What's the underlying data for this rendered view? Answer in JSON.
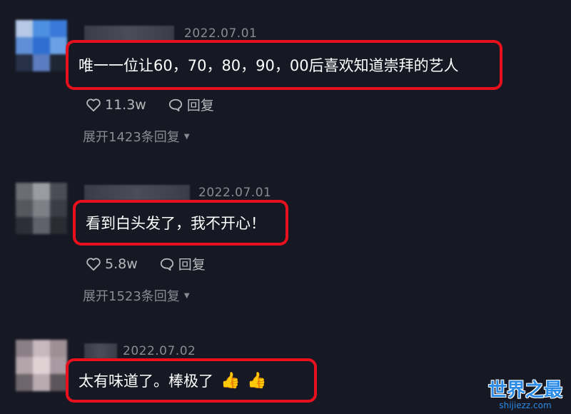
{
  "comments": [
    {
      "date": "2022.07.01",
      "text": "唯一一位让60，70，80，90，00后喜欢知道崇拜的艺人",
      "likes": "11.3w",
      "reply_label": "回复",
      "expand_label": "展开1423条回复",
      "emojis": []
    },
    {
      "date": "2022.07.01",
      "text": "看到白头发了，我不开心！",
      "likes": "5.8w",
      "reply_label": "回复",
      "expand_label": "展开1523条回复",
      "emojis": []
    },
    {
      "date": "2022.07.02",
      "text": "太有味道了。棒极了",
      "emojis": [
        "👍",
        "👍"
      ]
    }
  ],
  "icons": {
    "like": "heart-icon",
    "reply": "speech-bubble-icon",
    "expand": "caret-down-icon",
    "emoji": "thumbs-up-emoji"
  },
  "colors": {
    "background": "#161823",
    "highlight_border": "#e8101c",
    "meta_text": "#8a8b91",
    "watermark": "#2b8be6"
  },
  "watermark": {
    "title": "世界之最",
    "subtitle": "shijiezz.com"
  }
}
